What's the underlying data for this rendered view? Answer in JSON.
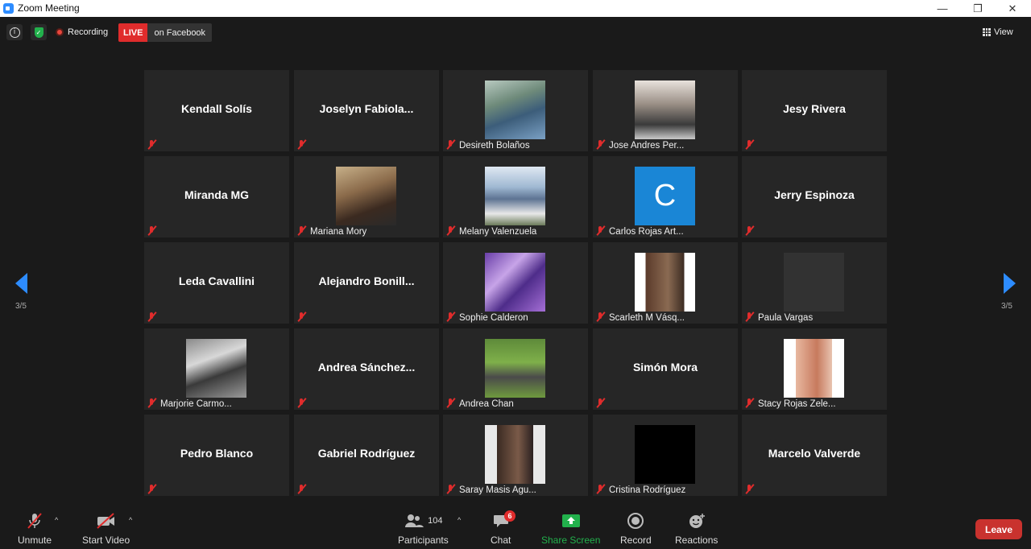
{
  "window": {
    "title": "Zoom Meeting",
    "minimize_glyph": "—",
    "restore_glyph": "❐",
    "close_glyph": "✕"
  },
  "topbar": {
    "recording_label": "Recording",
    "live_badge": "LIVE",
    "live_destination": "on Facebook",
    "view_label": "View"
  },
  "pagination": {
    "left": "3/5",
    "right": "3/5"
  },
  "tiles": [
    {
      "name": "Kendall Solís",
      "label": ""
    },
    {
      "name": "Joselyn  Fabiola...",
      "label": ""
    },
    {
      "name": "",
      "label": "Desireth Bolaños"
    },
    {
      "name": "",
      "label": "Jose Andres Per..."
    },
    {
      "name": "Jesy Rivera",
      "label": ""
    },
    {
      "name": "Miranda MG",
      "label": ""
    },
    {
      "name": "",
      "label": "Mariana Mory"
    },
    {
      "name": "",
      "label": "Melany Valenzuela"
    },
    {
      "name": "",
      "label": "Carlos Rojas Art...",
      "avatar_letter": "C"
    },
    {
      "name": "Jerry Espinoza",
      "label": ""
    },
    {
      "name": "Leda Cavallini",
      "label": ""
    },
    {
      "name": "Alejandro  Bonill...",
      "label": ""
    },
    {
      "name": "",
      "label": "Sophie Calderon"
    },
    {
      "name": "",
      "label": "Scarleth M Vásq..."
    },
    {
      "name": "",
      "label": "Paula Vargas"
    },
    {
      "name": "",
      "label": "Marjorie Carmo..."
    },
    {
      "name": "Andrea  Sánchez...",
      "label": ""
    },
    {
      "name": "",
      "label": "Andrea Chan"
    },
    {
      "name": "Simón Mora",
      "label": ""
    },
    {
      "name": "",
      "label": "Stacy Rojas Zele..."
    },
    {
      "name": "Pedro Blanco",
      "label": ""
    },
    {
      "name": "Gabriel Rodríguez",
      "label": ""
    },
    {
      "name": "",
      "label": "Saray Masis Agu..."
    },
    {
      "name": "",
      "label": "Cristina Rodríguez"
    },
    {
      "name": "Marcelo Valverde",
      "label": ""
    }
  ],
  "toolbar": {
    "unmute_label": "Unmute",
    "start_video_label": "Start Video",
    "participants_label": "Participants",
    "participants_count": "104",
    "chat_label": "Chat",
    "chat_badge": "6",
    "share_screen_label": "Share Screen",
    "record_label": "Record",
    "reactions_label": "Reactions",
    "leave_label": "Leave",
    "caret": "^"
  },
  "colors": {
    "accent": "#2d8cff",
    "share_green": "#22b14c",
    "leave_red": "#c9322e",
    "muted_red": "#e02c2c",
    "tile_bg": "#262626"
  }
}
